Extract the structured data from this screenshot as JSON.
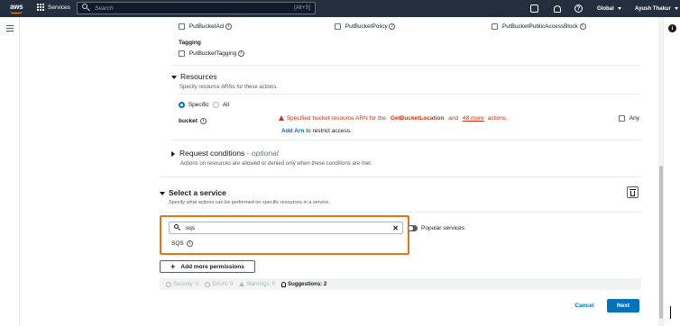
{
  "topnav": {
    "logo_text": "aws",
    "services_label": "Services",
    "search_placeholder": "Search",
    "search_shortcut": "[Alt+S]",
    "region": "Global",
    "user": "Ayush Thakur"
  },
  "actions": {
    "row1": [
      "PutBucketAcl",
      "PutBucketPolicy",
      "PutBucketPublicAccessBlock"
    ],
    "tagging_label": "Tagging",
    "tagging_items": [
      "PutBucketTagging"
    ]
  },
  "resources": {
    "title": "Resources",
    "description": "Specify resource ARNs for these actions.",
    "radio_specific": "Specific",
    "radio_all": "All",
    "bucket_label": "bucket",
    "error_prefix": "Specified bucket resource ARN for the",
    "error_action": "GetBucketLocation",
    "error_and": "and",
    "error_more": "48 more",
    "error_suffix": "actions.",
    "add_arn_link": "Add Arn",
    "add_arn_suffix": "to restrict access.",
    "any_label": "Any"
  },
  "request_conditions": {
    "title": "Request conditions",
    "optional": "- optional",
    "description": "Actions on resources are allowed or denied only when these conditions are met."
  },
  "select_service": {
    "title": "Select a service",
    "description": "Specify what actions can be performed on specific resources in a service.",
    "search_value": "sqs",
    "clear_symbol": "✕",
    "popular_services_label": "Popular services",
    "result": "SQS"
  },
  "footer": {
    "add_more_label": "Add more permissions",
    "status": {
      "security": "Security: 0",
      "errors": "Errors: 0",
      "warnings": "Warnings: 0",
      "suggestions": "Suggestions: 2"
    },
    "cancel_label": "Cancel",
    "next_label": "Next"
  },
  "colors": {
    "nav_bg": "#232f3e",
    "accent_blue": "#0073bb",
    "error_red": "#d13212",
    "highlight_orange": "#ec7211"
  }
}
